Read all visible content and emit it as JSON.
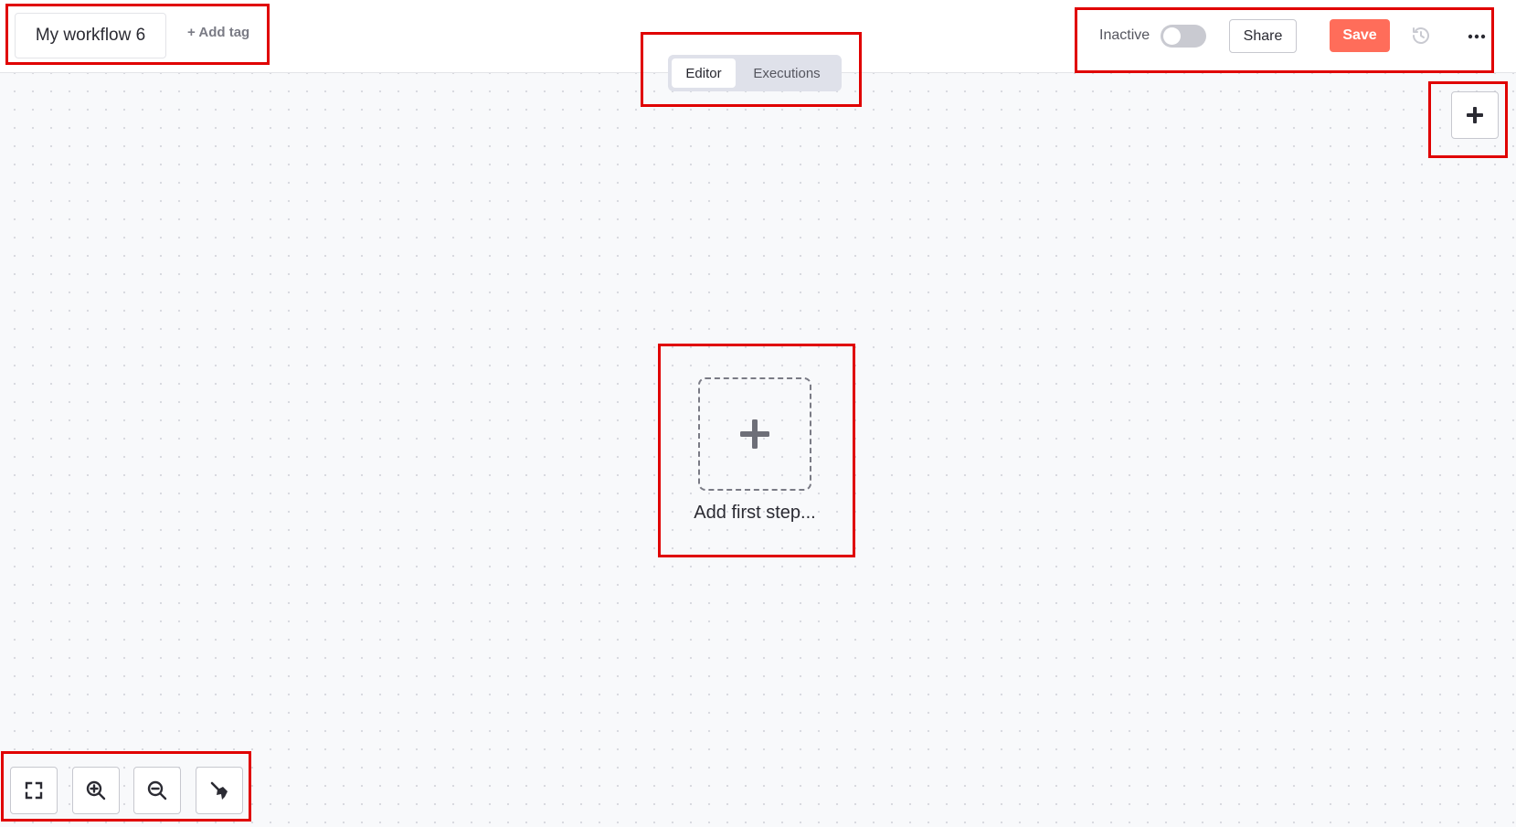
{
  "header": {
    "workflow_name": "My workflow 6",
    "add_tag_label": "+ Add tag",
    "tabs": [
      {
        "label": "Editor",
        "active": true
      },
      {
        "label": "Executions",
        "active": false
      }
    ],
    "status_label": "Inactive",
    "active_toggle_on": false,
    "share_label": "Share",
    "save_label": "Save"
  },
  "canvas": {
    "first_step_label": "Add first step..."
  },
  "icons": {
    "add_node": "plus-icon",
    "first_step": "plus-icon",
    "history": "history-icon",
    "more": "ellipsis-icon",
    "fit_view": "fullscreen-icon",
    "zoom_in": "zoom-in-icon",
    "zoom_out": "zoom-out-icon",
    "tidy_up": "broom-icon"
  },
  "colors": {
    "accent": "#ff6d5a",
    "annotation": "#e00000",
    "canvas_bg": "#f8f9fb"
  }
}
